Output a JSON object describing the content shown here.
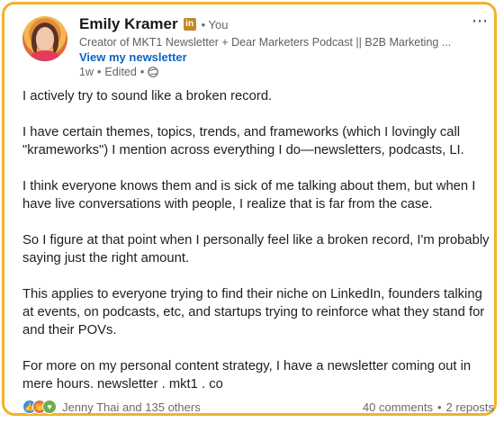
{
  "post": {
    "author": {
      "name": "Emily Kramer",
      "badge": "in",
      "relationship": "• You",
      "headline": "Creator of MKT1 Newsletter + Dear Marketers Podcast || B2B Marketing ...",
      "cta_label": "View my newsletter",
      "time": "1w",
      "edited_label": "Edited",
      "visibility_icon": "globe-icon"
    },
    "more_icon": "more-horizontal-icon",
    "paragraphs": [
      "I actively try to sound like a broken record.",
      "I have certain themes, topics, trends, and frameworks (which I lovingly call \"krameworks\") I mention across everything I do—newsletters, podcasts, LI.",
      "I think everyone knows them and is sick of me talking about them, but when I have live conversations with people, I realize that is far from the case.",
      "So I figure at that point when I personally feel like a broken record, I'm probably saying just the right amount.",
      "This applies to everyone trying to find their niche on LinkedIn, founders talking at events, on podcasts, etc, and startups trying to reinforce what they stand for and their POVs.",
      "For more on my personal content strategy, I have a newsletter coming out in mere hours. newsletter . mkt1 . co"
    ],
    "footer": {
      "reaction_icons": [
        "like-icon",
        "celebrate-icon",
        "support-icon"
      ],
      "reactions_text": "Jenny Thai and 135 others",
      "comments_text": "40 comments",
      "separator": "•",
      "reposts_text": "2 reposts"
    },
    "colors": {
      "frame_border": "#f2b229",
      "link": "#0a66c2"
    }
  }
}
